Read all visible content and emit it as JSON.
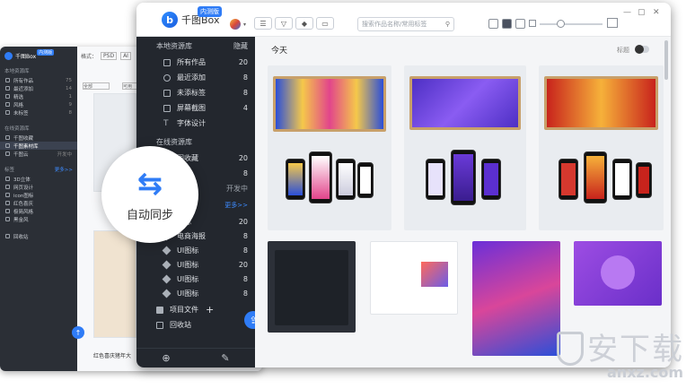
{
  "app": {
    "name": "千图Box",
    "beta": "内测版"
  },
  "search": {
    "placeholder": "搜索作品名称/常用标签"
  },
  "window_controls": {
    "minimize": "—",
    "maximize": "▢",
    "close": "✕"
  },
  "sidebar": {
    "local_title": "本地资源库",
    "local_action": "隐藏",
    "local_items": [
      {
        "label": "所有作品",
        "count": "20"
      },
      {
        "label": "最近添加",
        "count": "8"
      },
      {
        "label": "未添标签",
        "count": "8"
      },
      {
        "label": "屏幕截图",
        "count": "4"
      },
      {
        "label": "字体设计",
        "count": ""
      }
    ],
    "online_title": "在线资源库",
    "online_items": [
      {
        "label": "图收藏",
        "count": "20"
      },
      {
        "label": "材库",
        "count": "8"
      },
      {
        "label": "",
        "count": "开发中"
      }
    ],
    "tags_more": "更多>>",
    "tag_items": [
      {
        "label": "图标",
        "count": "20"
      },
      {
        "label": "电商海报",
        "count": "8"
      },
      {
        "label": "UI图标",
        "count": "8"
      },
      {
        "label": "UI图标",
        "count": "20"
      },
      {
        "label": "UI图标",
        "count": "8"
      },
      {
        "label": "UI图标",
        "count": "8"
      }
    ],
    "folder_label": "项目文件",
    "recycle_label": "回收站"
  },
  "main": {
    "date_heading": "今天",
    "toggle_label": "标题"
  },
  "sync": {
    "label": "自动同步",
    "icon": "sync-arrows-icon"
  },
  "back_window": {
    "app_name": "千图Box",
    "beta": "内测版",
    "local_title": "本地资源库",
    "local_items": [
      {
        "label": "所有作品",
        "count": "75"
      },
      {
        "label": "最近添加",
        "count": "14"
      },
      {
        "label": "精选",
        "count": "1"
      },
      {
        "label": "风格",
        "count": "9"
      },
      {
        "label": "未标签",
        "count": "8"
      }
    ],
    "online_title": "在线资源库",
    "online_items": [
      {
        "label": "千图收藏",
        "count": ""
      },
      {
        "label": "千图素材库",
        "count": ""
      },
      {
        "label": "千图云",
        "count": "开发中"
      }
    ],
    "tags_title": "标签",
    "tags_more": "更多>>",
    "tag_items": [
      {
        "label": "3D立体",
        "count": ""
      },
      {
        "label": "网页设计",
        "count": ""
      },
      {
        "label": "icon图标",
        "count": ""
      },
      {
        "label": "红色喜庆",
        "count": ""
      },
      {
        "label": "极简风格",
        "count": ""
      },
      {
        "label": "黑金风",
        "count": ""
      }
    ],
    "recycle_label": "回收站",
    "toolbar": {
      "format_label": "格式：",
      "psd": "PSD",
      "ai": "AI",
      "all": "全部",
      "available": "可用"
    },
    "caption": "红色喜庆猪年大"
  },
  "watermark": {
    "big": "安下载",
    "small": "anxz.com"
  },
  "colors": {
    "accent": "#2f7cf6",
    "sidebar": "#23272e",
    "frame": "#c8a06a"
  }
}
